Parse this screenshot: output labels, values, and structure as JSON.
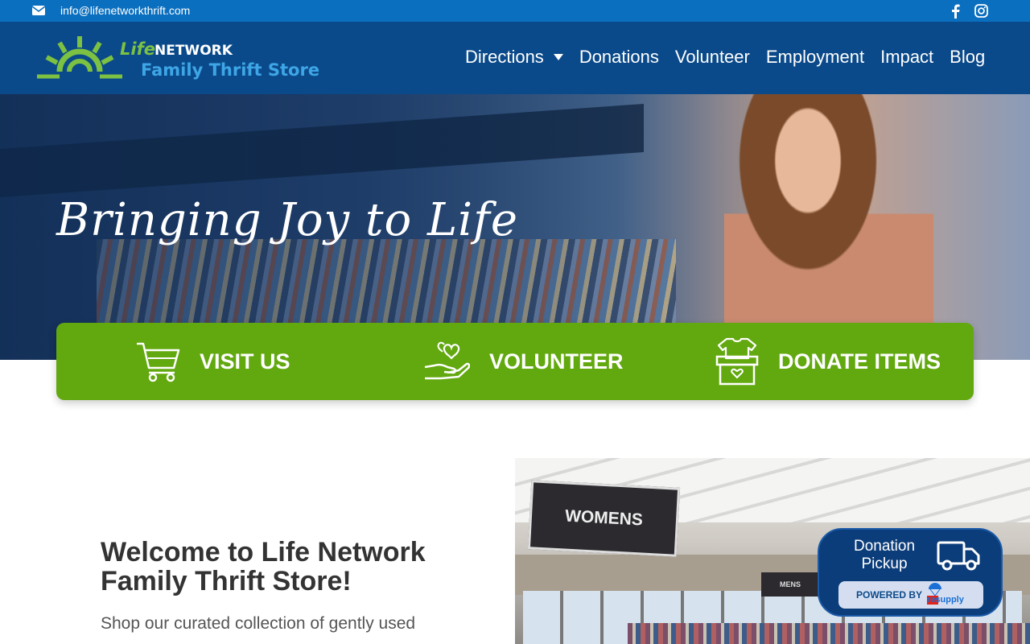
{
  "topbar": {
    "email": "info@lifenetworkthrift.com",
    "icons": [
      "envelope-icon",
      "facebook-icon",
      "instagram-icon"
    ]
  },
  "logo": {
    "life": "Life",
    "network": "NETWORK",
    "store": "Family Thrift Store"
  },
  "nav": {
    "items": [
      {
        "label": "Directions",
        "has_dropdown": true
      },
      {
        "label": "Donations"
      },
      {
        "label": "Volunteer"
      },
      {
        "label": "Employment"
      },
      {
        "label": "Impact"
      },
      {
        "label": "Blog"
      }
    ]
  },
  "hero": {
    "tagline": "Bringing Joy to Life"
  },
  "cta": {
    "items": [
      {
        "label": "VISIT US",
        "icon": "shopping-cart-icon"
      },
      {
        "label": "VOLUNTEER",
        "icon": "heart-hand-icon"
      },
      {
        "label": "DONATE ITEMS",
        "icon": "donation-box-icon"
      }
    ]
  },
  "welcome": {
    "title": "Welcome to Life Network Family Thrift Store!",
    "text": "Shop our curated collection of gently used"
  },
  "store_photo": {
    "sign_women": "WOMENS",
    "sign_mens": "MENS"
  },
  "pickup": {
    "title": "Donation Pickup",
    "powered_label": "POWERED BY",
    "brand": "resupply",
    "icon": "truck-icon"
  },
  "colors": {
    "topbar": "#0b6fbf",
    "navbar": "#0b4a8a",
    "cta_green": "#62a80f",
    "logo_green": "#7cc142",
    "logo_blue": "#3ea6e6"
  }
}
